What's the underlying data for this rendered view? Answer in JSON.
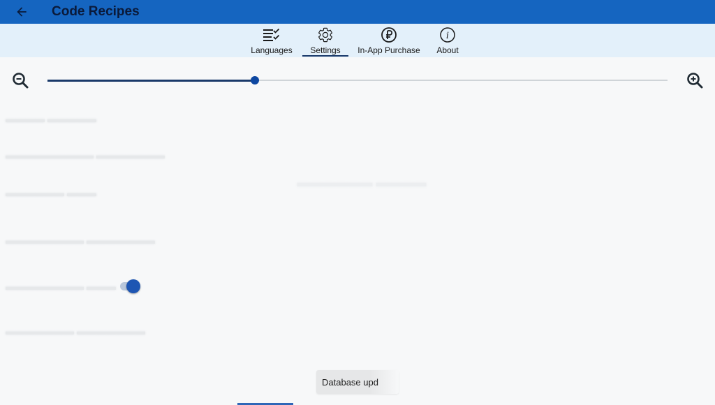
{
  "appbar": {
    "title": "Code Recipes",
    "back_icon": "arrow-back-icon",
    "background_color": "#1565c0"
  },
  "tabs": [
    {
      "label": "Languages",
      "icon": "list-check-icon",
      "active": false
    },
    {
      "label": "Settings",
      "icon": "gear-icon",
      "active": true
    },
    {
      "label": "In-App Purchase",
      "icon": "ruble-coin-icon",
      "active": false
    },
    {
      "label": "About",
      "icon": "info-icon",
      "active": false
    }
  ],
  "zoom": {
    "zoom_out_icon": "zoom-out-icon",
    "zoom_in_icon": "zoom-in-icon",
    "slider_value_fraction": 0.334,
    "accent_color": "#0d47a1"
  },
  "settings_toggle": {
    "on": true
  },
  "toast": {
    "text": "Database upd"
  }
}
